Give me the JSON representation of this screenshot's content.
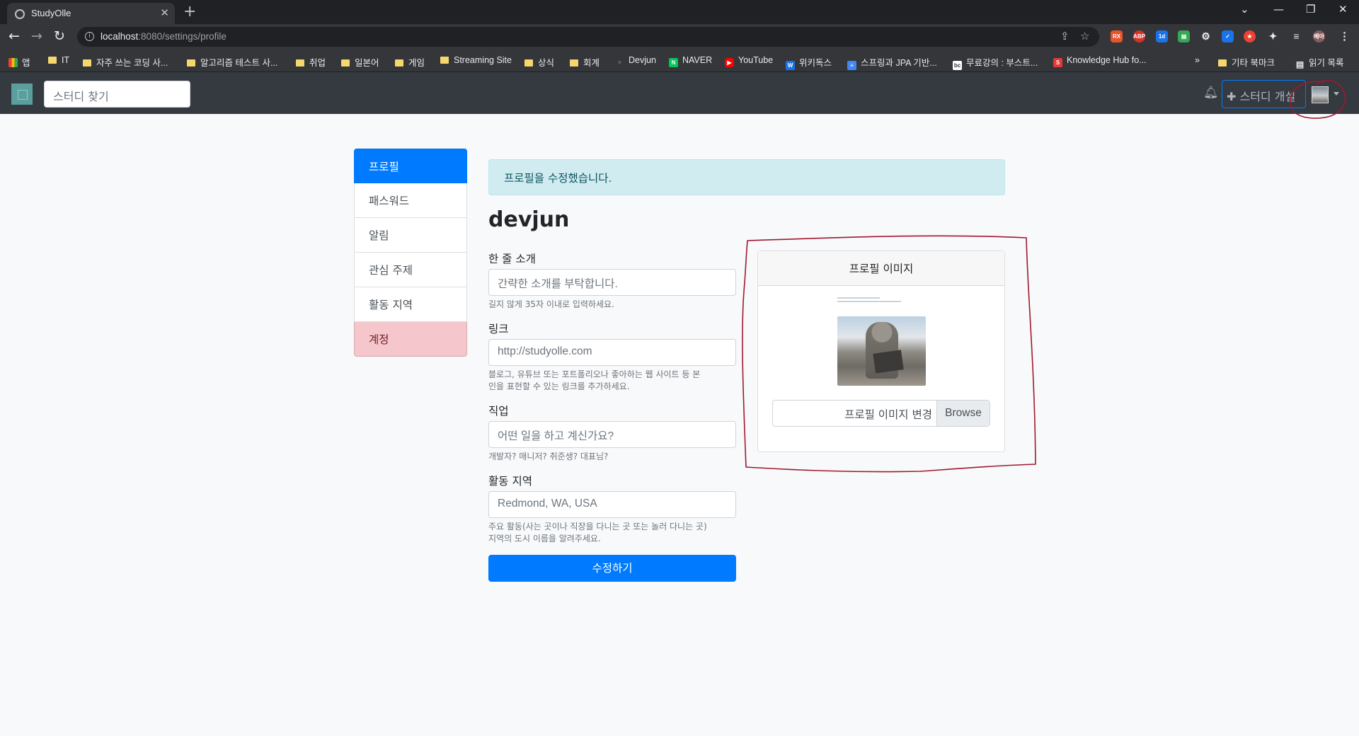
{
  "browser": {
    "tab_title": "StudyOlle",
    "url_host": "localhost",
    "url_rest": ":8080/settings/profile",
    "bookmarks": [
      "앱",
      "IT",
      "자주 쓰는 코딩 사...",
      "알고리즘 테스트 사...",
      "취업",
      "일본어",
      "게임",
      "Streaming Site",
      "상식",
      "회계",
      "Devjun",
      "NAVER",
      "YouTube",
      "위키독스",
      "스프링과 JPA 기반...",
      "무료강의 : 부스트...",
      "Knowledge Hub fo...",
      "»",
      "기타 북마크",
      "읽기 목록"
    ],
    "profile_chip": "베아"
  },
  "navbar": {
    "search_placeholder": "스터디 찾기",
    "create_label": "✚ 스터디 개설"
  },
  "menu": [
    "프로필",
    "패스워드",
    "알림",
    "관심 주제",
    "활동 지역",
    "계정"
  ],
  "alert": "프로필을 수정했습니다.",
  "username": "devjun",
  "form": {
    "bio_label": "한 줄 소개",
    "bio_placeholder": "간략한 소개를 부탁합니다.",
    "bio_help": "길지 않게 35자 이내로 입력하세요.",
    "url_label": "링크",
    "url_placeholder": "http://studyolle.com",
    "url_help_1": "블로그, 유튜브 또는 포트폴리오나 좋아하는 웹 사이트 등 본",
    "url_help_2": "인을 표현할 수 있는 링크를 추가하세요.",
    "job_label": "직업",
    "job_placeholder": "어떤 일을 하고 계신가요?",
    "job_help": "개발자? 매니저? 취준생? 대표님?",
    "location_label": "활동 지역",
    "location_placeholder": "Redmond, WA, USA",
    "location_help_1": "주요 활동(사는 곳이나 직장을 다니는 곳 또는 놀러 다니는 곳)",
    "location_help_2": "지역의 도시 이름을 알려주세요.",
    "submit": "수정하기"
  },
  "image_card": {
    "header": "프로필 이미지",
    "file_label": "프로필 이미지 변경",
    "browse": "Browse"
  },
  "colors": {
    "primary": "#007bff",
    "danger_bg": "#f5c6cb",
    "alert_bg": "#d1ecf1",
    "navbar": "#343a40",
    "annotation": "#a01830"
  }
}
